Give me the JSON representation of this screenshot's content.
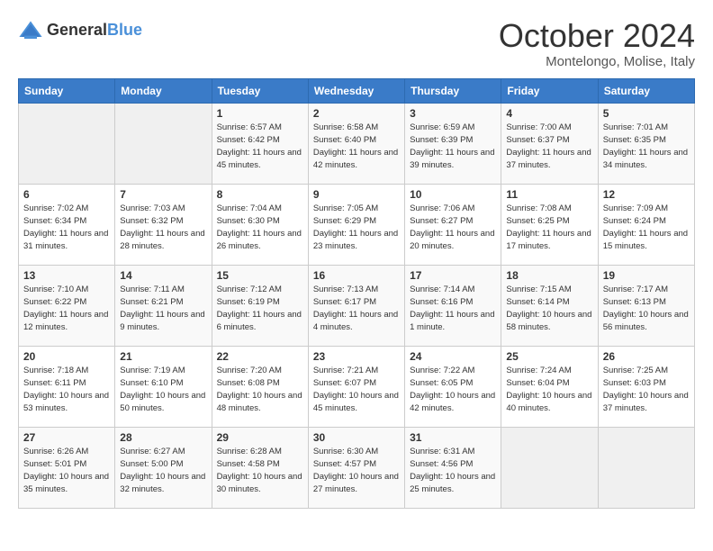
{
  "header": {
    "logo_general": "General",
    "logo_blue": "Blue",
    "month": "October 2024",
    "location": "Montelongo, Molise, Italy"
  },
  "weekdays": [
    "Sunday",
    "Monday",
    "Tuesday",
    "Wednesday",
    "Thursday",
    "Friday",
    "Saturday"
  ],
  "weeks": [
    [
      null,
      null,
      {
        "day": 1,
        "sunrise": "6:57 AM",
        "sunset": "6:42 PM",
        "daylight": "11 hours and 45 minutes."
      },
      {
        "day": 2,
        "sunrise": "6:58 AM",
        "sunset": "6:40 PM",
        "daylight": "11 hours and 42 minutes."
      },
      {
        "day": 3,
        "sunrise": "6:59 AM",
        "sunset": "6:39 PM",
        "daylight": "11 hours and 39 minutes."
      },
      {
        "day": 4,
        "sunrise": "7:00 AM",
        "sunset": "6:37 PM",
        "daylight": "11 hours and 37 minutes."
      },
      {
        "day": 5,
        "sunrise": "7:01 AM",
        "sunset": "6:35 PM",
        "daylight": "11 hours and 34 minutes."
      }
    ],
    [
      {
        "day": 6,
        "sunrise": "7:02 AM",
        "sunset": "6:34 PM",
        "daylight": "11 hours and 31 minutes."
      },
      {
        "day": 7,
        "sunrise": "7:03 AM",
        "sunset": "6:32 PM",
        "daylight": "11 hours and 28 minutes."
      },
      {
        "day": 8,
        "sunrise": "7:04 AM",
        "sunset": "6:30 PM",
        "daylight": "11 hours and 26 minutes."
      },
      {
        "day": 9,
        "sunrise": "7:05 AM",
        "sunset": "6:29 PM",
        "daylight": "11 hours and 23 minutes."
      },
      {
        "day": 10,
        "sunrise": "7:06 AM",
        "sunset": "6:27 PM",
        "daylight": "11 hours and 20 minutes."
      },
      {
        "day": 11,
        "sunrise": "7:08 AM",
        "sunset": "6:25 PM",
        "daylight": "11 hours and 17 minutes."
      },
      {
        "day": 12,
        "sunrise": "7:09 AM",
        "sunset": "6:24 PM",
        "daylight": "11 hours and 15 minutes."
      }
    ],
    [
      {
        "day": 13,
        "sunrise": "7:10 AM",
        "sunset": "6:22 PM",
        "daylight": "11 hours and 12 minutes."
      },
      {
        "day": 14,
        "sunrise": "7:11 AM",
        "sunset": "6:21 PM",
        "daylight": "11 hours and 9 minutes."
      },
      {
        "day": 15,
        "sunrise": "7:12 AM",
        "sunset": "6:19 PM",
        "daylight": "11 hours and 6 minutes."
      },
      {
        "day": 16,
        "sunrise": "7:13 AM",
        "sunset": "6:17 PM",
        "daylight": "11 hours and 4 minutes."
      },
      {
        "day": 17,
        "sunrise": "7:14 AM",
        "sunset": "6:16 PM",
        "daylight": "11 hours and 1 minute."
      },
      {
        "day": 18,
        "sunrise": "7:15 AM",
        "sunset": "6:14 PM",
        "daylight": "10 hours and 58 minutes."
      },
      {
        "day": 19,
        "sunrise": "7:17 AM",
        "sunset": "6:13 PM",
        "daylight": "10 hours and 56 minutes."
      }
    ],
    [
      {
        "day": 20,
        "sunrise": "7:18 AM",
        "sunset": "6:11 PM",
        "daylight": "10 hours and 53 minutes."
      },
      {
        "day": 21,
        "sunrise": "7:19 AM",
        "sunset": "6:10 PM",
        "daylight": "10 hours and 50 minutes."
      },
      {
        "day": 22,
        "sunrise": "7:20 AM",
        "sunset": "6:08 PM",
        "daylight": "10 hours and 48 minutes."
      },
      {
        "day": 23,
        "sunrise": "7:21 AM",
        "sunset": "6:07 PM",
        "daylight": "10 hours and 45 minutes."
      },
      {
        "day": 24,
        "sunrise": "7:22 AM",
        "sunset": "6:05 PM",
        "daylight": "10 hours and 42 minutes."
      },
      {
        "day": 25,
        "sunrise": "7:24 AM",
        "sunset": "6:04 PM",
        "daylight": "10 hours and 40 minutes."
      },
      {
        "day": 26,
        "sunrise": "7:25 AM",
        "sunset": "6:03 PM",
        "daylight": "10 hours and 37 minutes."
      }
    ],
    [
      {
        "day": 27,
        "sunrise": "6:26 AM",
        "sunset": "5:01 PM",
        "daylight": "10 hours and 35 minutes."
      },
      {
        "day": 28,
        "sunrise": "6:27 AM",
        "sunset": "5:00 PM",
        "daylight": "10 hours and 32 minutes."
      },
      {
        "day": 29,
        "sunrise": "6:28 AM",
        "sunset": "4:58 PM",
        "daylight": "10 hours and 30 minutes."
      },
      {
        "day": 30,
        "sunrise": "6:30 AM",
        "sunset": "4:57 PM",
        "daylight": "10 hours and 27 minutes."
      },
      {
        "day": 31,
        "sunrise": "6:31 AM",
        "sunset": "4:56 PM",
        "daylight": "10 hours and 25 minutes."
      },
      null,
      null
    ]
  ]
}
